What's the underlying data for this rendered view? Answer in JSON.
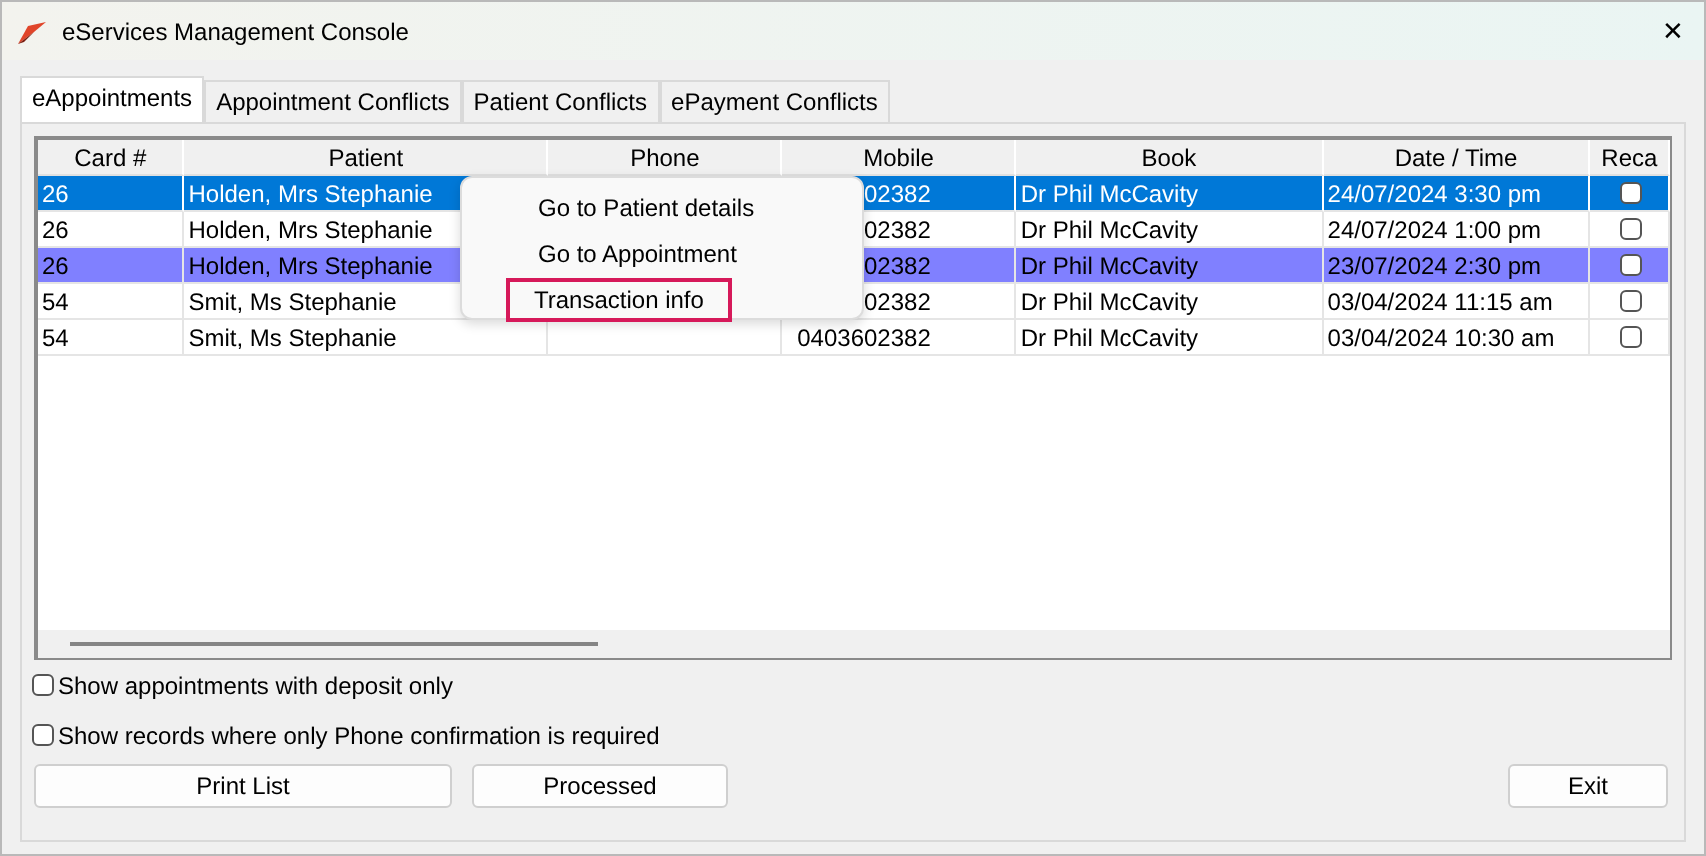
{
  "window": {
    "title": "eServices Management Console",
    "close": "✕"
  },
  "tabs": [
    {
      "label": "eAppointments",
      "selected": true
    },
    {
      "label": "Appointment Conflicts",
      "selected": false
    },
    {
      "label": "Patient Conflicts",
      "selected": false
    },
    {
      "label": "ePayment Conflicts",
      "selected": false
    }
  ],
  "table": {
    "columns": [
      "Card #",
      "Patient",
      "Phone",
      "Mobile",
      "Book",
      "Date / Time",
      "Reca"
    ],
    "rows": [
      {
        "card": "26",
        "patient": "Holden, Mrs Stephanie",
        "mobile": "02382",
        "book": "Dr Phil McCavity",
        "datetime": "24/07/2024 3:30 pm",
        "recall": false,
        "selected": true,
        "marked": false
      },
      {
        "card": "26",
        "patient": "Holden, Mrs Stephanie",
        "mobile": "02382",
        "book": "Dr Phil McCavity",
        "datetime": "24/07/2024 1:00 pm",
        "recall": false,
        "selected": false,
        "marked": false
      },
      {
        "card": "26",
        "patient": "Holden, Mrs Stephanie",
        "mobile": "02382",
        "book": "Dr Phil McCavity",
        "datetime": "23/07/2024 2:30 pm",
        "recall": false,
        "selected": false,
        "marked": true
      },
      {
        "card": "54",
        "patient": "Smit, Ms Stephanie",
        "mobile": "02382",
        "book": "Dr Phil McCavity",
        "datetime": "03/04/2024 11:15 am",
        "recall": false,
        "selected": false,
        "marked": false
      },
      {
        "card": "54",
        "patient": "Smit, Ms Stephanie",
        "mobile": "0403602382",
        "book": "Dr Phil McCavity",
        "datetime": "03/04/2024 10:30 am",
        "recall": false,
        "selected": false,
        "marked": false
      }
    ]
  },
  "context_menu": {
    "items": [
      {
        "label": "Go to Patient details",
        "highlighted": false
      },
      {
        "label": "Go to Appointment",
        "highlighted": false
      },
      {
        "label": "Transaction info",
        "highlighted": true
      }
    ]
  },
  "options": [
    {
      "label": "Show appointments with deposit only",
      "checked": false
    },
    {
      "label": "Show records where only Phone confirmation is required",
      "checked": false
    }
  ],
  "buttons": {
    "left": [
      "Print List",
      "Processed"
    ],
    "right": [
      "Exit"
    ]
  }
}
